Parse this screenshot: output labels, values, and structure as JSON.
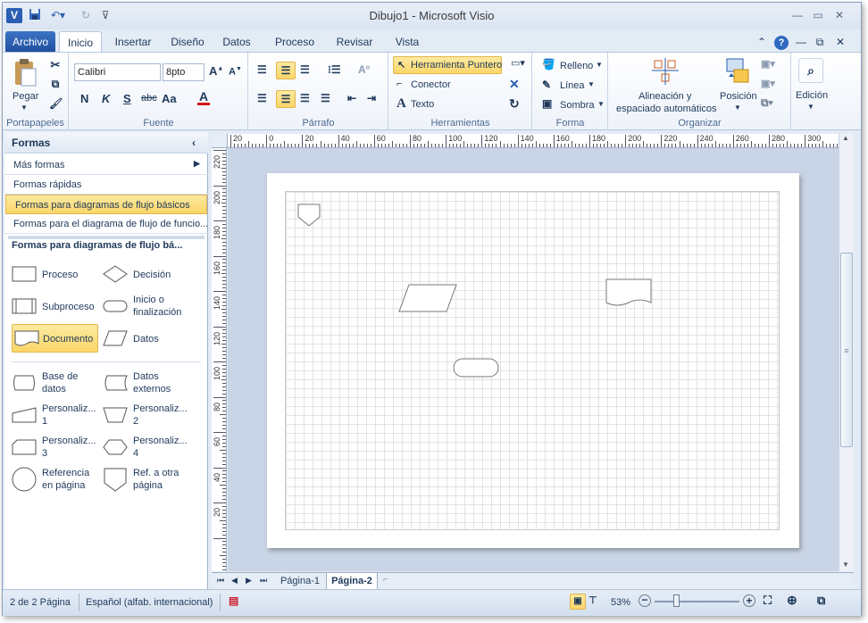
{
  "window": {
    "title": "Dibujo1 - Microsoft Visio"
  },
  "quick_access": {
    "save_icon": "save-icon",
    "undo_icon": "undo-icon",
    "redo_icon": "redo-icon",
    "customize_icon": "customize-icon"
  },
  "tabs": [
    {
      "label": "Archivo"
    },
    {
      "label": "Inicio"
    },
    {
      "label": "Insertar"
    },
    {
      "label": "Diseño"
    },
    {
      "label": "Datos"
    },
    {
      "label": "Proceso"
    },
    {
      "label": "Revisar"
    },
    {
      "label": "Vista"
    }
  ],
  "ribbon": {
    "clipboard": {
      "label": "Portapapeles",
      "paste": "Pegar"
    },
    "font": {
      "label": "Fuente",
      "font_name": "Calibri",
      "font_size": "8pto",
      "bold": "N",
      "italic": "K",
      "underline": "S",
      "strike": "abc",
      "case": "Aa",
      "color": "A"
    },
    "paragraph": {
      "label": "Párrafo"
    },
    "tools": {
      "label": "Herramientas",
      "pointer": "Herramienta Puntero",
      "connector": "Conector",
      "text": "Texto"
    },
    "shape": {
      "label": "Forma",
      "fill": "Relleno",
      "line": "Línea",
      "shadow": "Sombra"
    },
    "arrange": {
      "label": "Organizar",
      "align": "Alineación y",
      "align2": "espaciado automáticos",
      "position": "Posición"
    },
    "editing": {
      "label": "Edición"
    }
  },
  "sidebar": {
    "title": "Formas",
    "more": "Más formas",
    "quick": "Formas rápidas",
    "stencils": [
      "Formas para diagramas de flujo básicos",
      "Formas para el diagrama de flujo de funcio..."
    ],
    "stencil_title": "Formas para diagramas de flujo bá...",
    "shapes": [
      {
        "label": "Proceso"
      },
      {
        "label": "Decisión"
      },
      {
        "label": "Subproceso"
      },
      {
        "label": "Inicio o",
        "label2": "finalización"
      },
      {
        "label": "Documento"
      },
      {
        "label": "Datos"
      },
      {
        "label": "Base de",
        "label2": "datos"
      },
      {
        "label": "Datos",
        "label2": "externos"
      },
      {
        "label": "Personaliz...",
        "label2": "1"
      },
      {
        "label": "Personaliz...",
        "label2": "2"
      },
      {
        "label": "Personaliz...",
        "label2": "3"
      },
      {
        "label": "Personaliz...",
        "label2": "4"
      },
      {
        "label": "Referencia",
        "label2": "en página"
      },
      {
        "label": "Ref. a otra",
        "label2": "página"
      }
    ]
  },
  "ruler": {
    "h_ticks": [
      "20",
      "0",
      "20",
      "40",
      "60",
      "80",
      "100",
      "120",
      "140",
      "160",
      "180",
      "200",
      "220",
      "240",
      "260",
      "280",
      "300"
    ],
    "v_ticks": [
      "220",
      "200",
      "180",
      "160",
      "140",
      "120",
      "100",
      "80",
      "60",
      "40",
      "20"
    ]
  },
  "pages": {
    "tabs": [
      "Página-1",
      "Página-2"
    ]
  },
  "status": {
    "page": "2 de 2 Página",
    "language": "Español (alfab. internacional)",
    "zoom": "53%"
  }
}
